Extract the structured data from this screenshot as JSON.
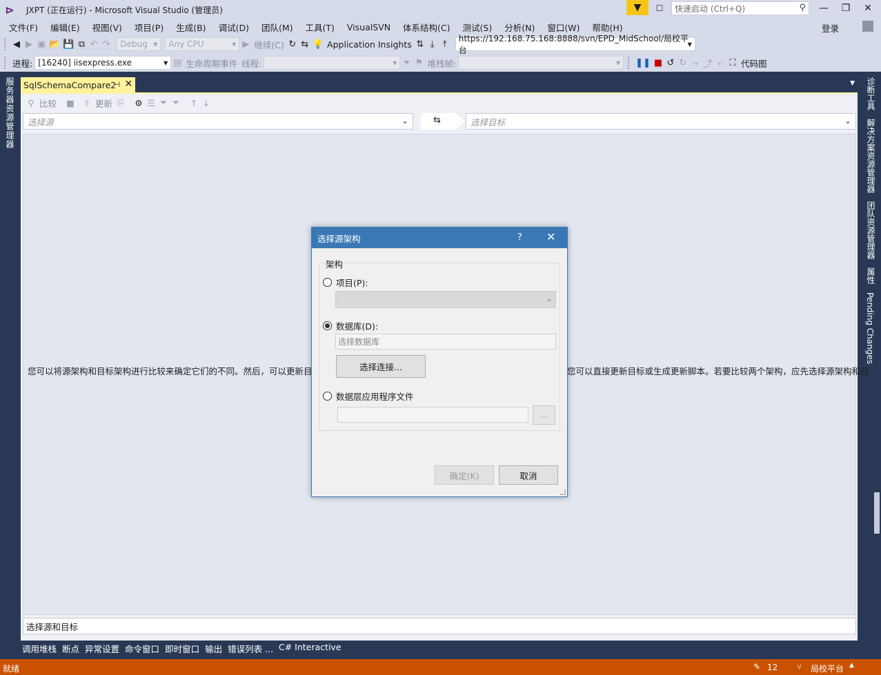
{
  "window": {
    "title": "JXPT (正在运行) - Microsoft Visual Studio (管理员)",
    "quick_launch_placeholder": "快速启动 (Ctrl+Q)",
    "min_glyph": "—",
    "max_glyph": "❐",
    "close_glyph": "✕"
  },
  "menu": {
    "items": [
      "文件(F)",
      "编辑(E)",
      "视图(V)",
      "项目(P)",
      "生成(B)",
      "调试(D)",
      "团队(M)",
      "工具(T)",
      "VisualSVN",
      "体系结构(C)",
      "测试(S)",
      "分析(N)",
      "窗口(W)",
      "帮助(H)"
    ],
    "login": "登录"
  },
  "toolbar1": {
    "config": "Debug",
    "platform": "Any CPU",
    "continue": "继续(C)",
    "app_insights": "Application Insights",
    "svn_url": "https://192.168.75.168:8888/svn/EPD_MidSchool/局校平台"
  },
  "toolbar2": {
    "process_label": "进程:",
    "process_value": "[16240] iisexpress.exe",
    "lifecycle": "生命周期事件",
    "thread_label": "线程:",
    "stack_label": "堆栈帧:",
    "code_map": "代码图"
  },
  "left_strip": {
    "tab": "服务器资源管理器"
  },
  "right_strip": {
    "tabs": [
      "诊断工具",
      "解决方案资源管理器",
      "团队资源管理器",
      "属性",
      "Pending Changes"
    ]
  },
  "document": {
    "tab_title": "SqlSchemaCompare2",
    "compare_toolbar": {
      "compare": "比较",
      "update": "更新"
    },
    "source_placeholder": "选择源",
    "target_placeholder": "选择目标",
    "info_left": "您可以将源架构和目标架构进行比较来确定它们的不同。然后，可以更新目标架",
    "info_right": "您可以直接更新目标或生成更新脚本。若要比较两个架构，应先选择源架构和目",
    "status_text": "选择源和目标"
  },
  "dialog": {
    "title": "选择源架构",
    "help": "?",
    "group_label": "架构",
    "option_project": "项目(P):",
    "option_database": "数据库(D):",
    "db_placeholder": "选择数据库",
    "connect_button": "选择连接...",
    "option_dacpac": "数据层应用程序文件",
    "browse": "...",
    "ok": "确定(K)",
    "cancel": "取消",
    "selected_option": "database"
  },
  "bottom_tabs": [
    "调用堆栈",
    "断点",
    "异常设置",
    "命令窗口",
    "即时窗口",
    "输出",
    "错误列表 ...",
    "C# Interactive"
  ],
  "statusbar": {
    "ready": "就绪",
    "pending_count": "12",
    "branch": "局校平台"
  },
  "colors": {
    "accent_titlebar": "#d6dbe9",
    "dark_frame": "#293955",
    "active_tab": "#fff29d",
    "status_bar": "#ca5100",
    "dialog_header": "#3a78b5"
  }
}
